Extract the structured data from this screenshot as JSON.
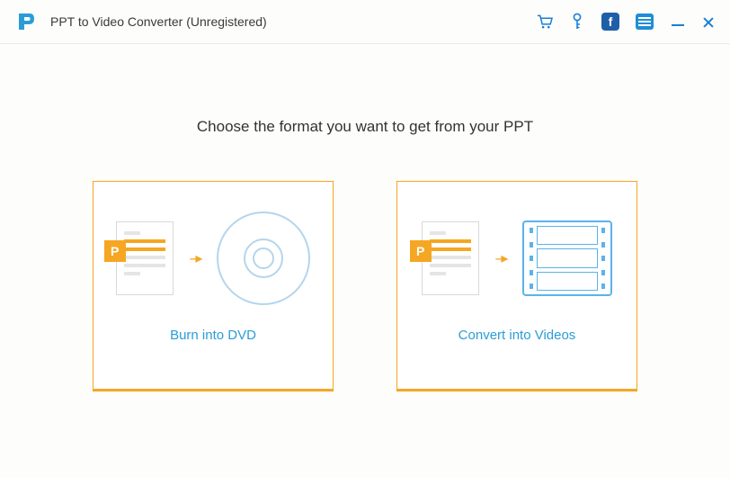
{
  "header": {
    "title": "PPT to Video Converter (Unregistered)"
  },
  "main": {
    "heading": "Choose the format you want to get from your PPT",
    "option_dvd": "Burn into DVD",
    "option_video": "Convert into Videos"
  }
}
